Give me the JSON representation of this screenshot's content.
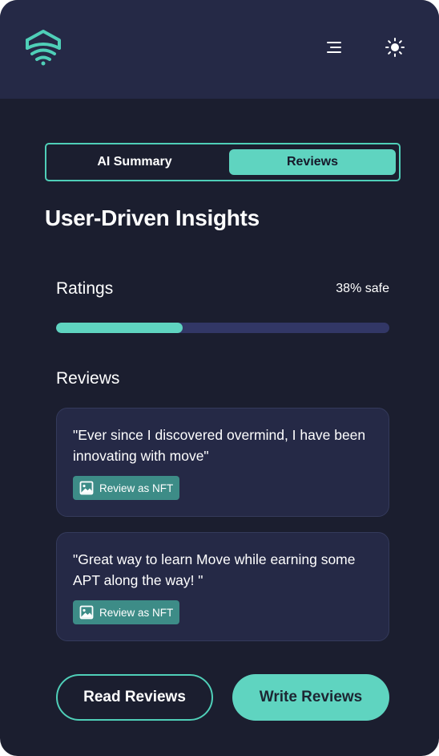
{
  "header": {
    "logo_icon": "shield-wifi-logo-icon",
    "menu_icon": "menu-icon",
    "theme_icon": "sun-icon",
    "accent_color": "#5fd4c0"
  },
  "tabs": [
    {
      "label": "AI Summary",
      "active": false
    },
    {
      "label": "Reviews",
      "active": true
    }
  ],
  "page_title": "User-Driven Insights",
  "ratings": {
    "label": "Ratings",
    "value_text": "38% safe",
    "percent": 38
  },
  "reviews": {
    "label": "Reviews",
    "items": [
      {
        "text": "\"Ever since I discovered overmind, I have been innovating with move\"",
        "nft_label": "Review as NFT",
        "nft_icon": "image-icon"
      },
      {
        "text": "\"Great way to learn Move while earning some APT along the way! \"",
        "nft_label": "Review as NFT",
        "nft_icon": "image-icon"
      }
    ]
  },
  "actions": {
    "read_label": "Read Reviews",
    "write_label": "Write Reviews"
  }
}
